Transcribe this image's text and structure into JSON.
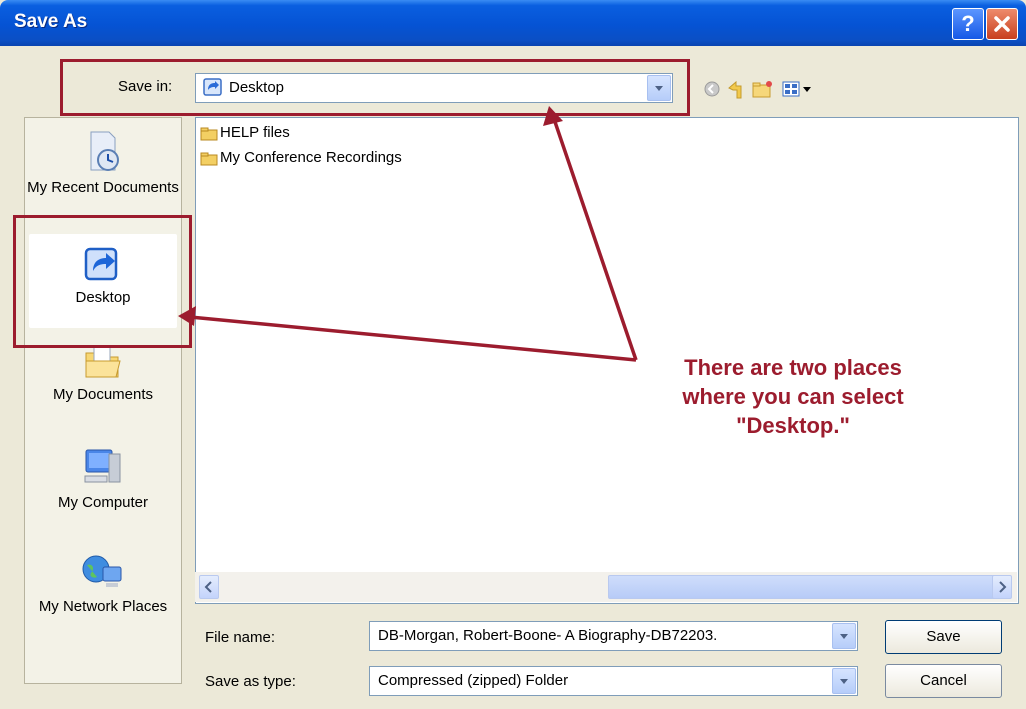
{
  "window": {
    "title": "Save As"
  },
  "title_buttons": {
    "help": "?"
  },
  "save_in": {
    "label": "Save in:",
    "value": "Desktop"
  },
  "toolbar": {
    "icons": [
      "back-icon",
      "up-folder-icon",
      "new-folder-icon",
      "views-menu-icon"
    ]
  },
  "places": [
    {
      "label": "My Recent Documents",
      "icon": "recent-documents-icon"
    },
    {
      "label": "Desktop",
      "icon": "desktop-icon"
    },
    {
      "label": "My Documents",
      "icon": "my-documents-icon"
    },
    {
      "label": "My Computer",
      "icon": "my-computer-icon"
    },
    {
      "label": "My Network Places",
      "icon": "network-places-icon"
    }
  ],
  "files": [
    {
      "name": "HELP files",
      "icon": "folder-icon"
    },
    {
      "name": "My Conference Recordings",
      "icon": "folder-icon"
    }
  ],
  "file_name": {
    "label": "File name:",
    "value": "DB-Morgan, Robert-Boone- A Biography-DB72203."
  },
  "save_as_type": {
    "label": "Save as type:",
    "value": "Compressed (zipped) Folder"
  },
  "buttons": {
    "save": "Save",
    "cancel": "Cancel"
  },
  "annotation": {
    "lines": [
      "There are two places",
      "where you can select",
      "\"Desktop.\""
    ],
    "color": "#9c1c2e"
  }
}
